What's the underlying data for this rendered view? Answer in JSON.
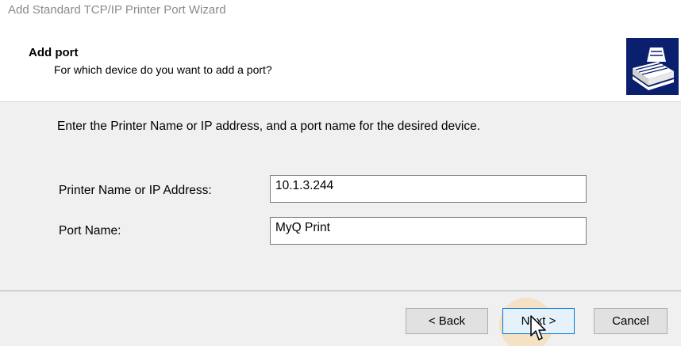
{
  "window": {
    "title": "Add Standard TCP/IP Printer Port Wizard"
  },
  "header": {
    "title": "Add port",
    "subtitle": "For which device do you want to add a port?",
    "icon": "printer-port-icon"
  },
  "content": {
    "instruction": "Enter the Printer Name or IP address, and a port name for the desired device.",
    "fields": [
      {
        "label": "Printer Name or IP Address:",
        "value": "10.1.3.244"
      },
      {
        "label": "Port Name:",
        "value": "MyQ Print"
      }
    ]
  },
  "buttons": {
    "back": "< Back",
    "next": "Next >",
    "cancel": "Cancel"
  },
  "colors": {
    "icon_background": "#0a1f6e",
    "focus_border": "#0078d7"
  }
}
